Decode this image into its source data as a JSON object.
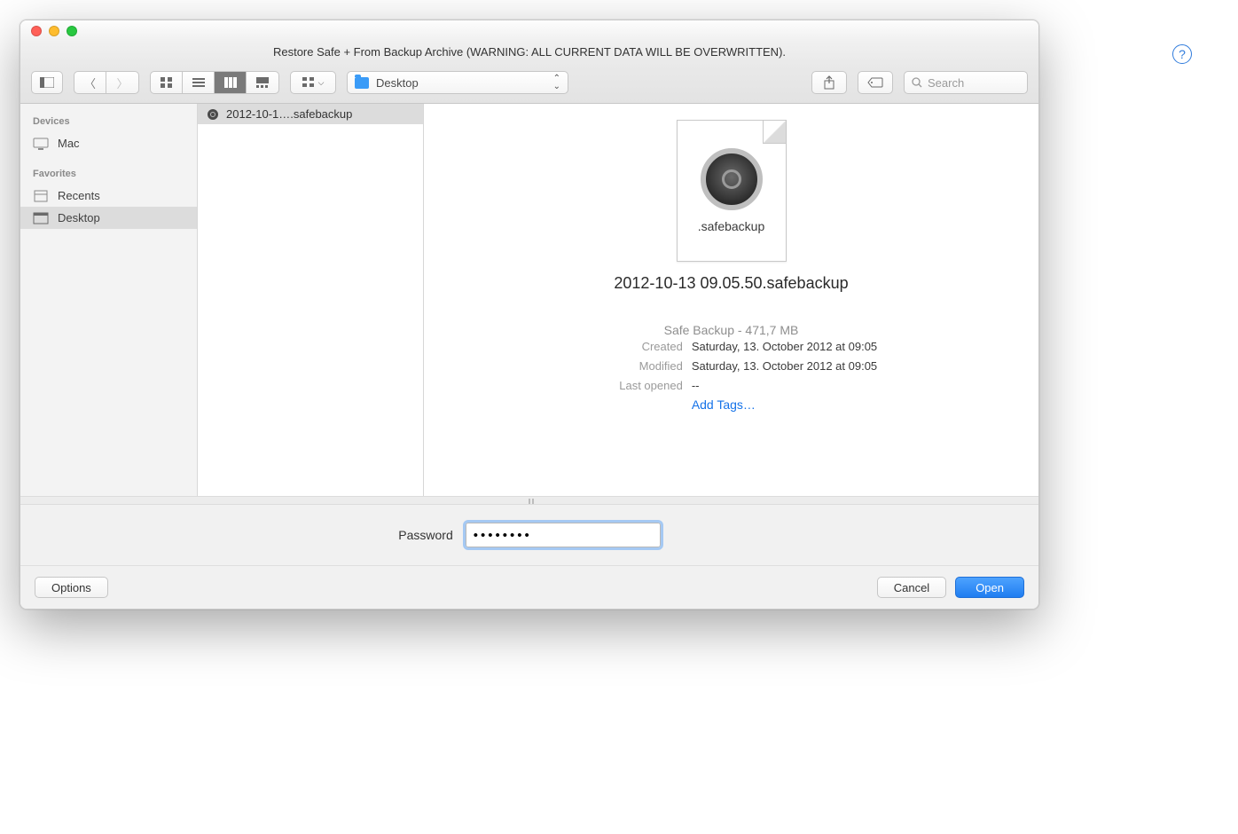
{
  "window": {
    "title": "Restore Safe + From Backup Archive (WARNING: ALL CURRENT DATA WILL BE OVERWRITTEN)."
  },
  "toolbar": {
    "path_label": "Desktop",
    "search_placeholder": "Search"
  },
  "sidebar": {
    "devices_header": "Devices",
    "devices": [
      {
        "label": "Mac"
      }
    ],
    "favorites_header": "Favorites",
    "favorites": [
      {
        "label": "Recents"
      },
      {
        "label": "Desktop",
        "selected": true
      }
    ]
  },
  "file_list": {
    "items": [
      {
        "name": "2012-10-1….safebackup"
      }
    ]
  },
  "preview": {
    "icon_ext": ".safebackup",
    "filename": "2012-10-13 09.05.50.safebackup",
    "type_line": "Safe Backup - 471,7 MB",
    "created_label": "Created",
    "created_value": "Saturday, 13. October 2012 at 09:05",
    "modified_label": "Modified",
    "modified_value": "Saturday, 13. October 2012 at 09:05",
    "lastopened_label": "Last opened",
    "lastopened_value": "--",
    "add_tags": "Add Tags…"
  },
  "password": {
    "label": "Password",
    "value": "••••••••"
  },
  "footer": {
    "options": "Options",
    "cancel": "Cancel",
    "open": "Open"
  },
  "help": "?"
}
